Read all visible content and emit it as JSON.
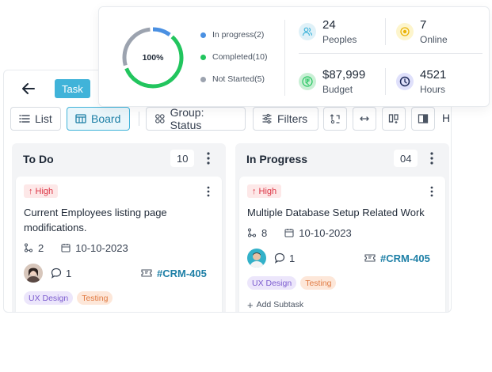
{
  "header": {
    "badge": "Task"
  },
  "toolbar": {
    "list_label": "List",
    "board_label": "Board",
    "group_label": "Group: Status",
    "filters_label": "Filters",
    "truncated_label": "Hi"
  },
  "columns": [
    {
      "title": "To Do",
      "count": "10",
      "card": {
        "priority": "High",
        "title": "Current Employees listing page modifications.",
        "subtasks": "2",
        "date": "10-10-2023",
        "comments": "1",
        "ticket": "#CRM-405",
        "tags": [
          "UX Design",
          "Testing"
        ]
      }
    },
    {
      "title": "In Progress",
      "count": "04",
      "card": {
        "priority": "High",
        "title": "Multiple Database Setup Related Work",
        "subtasks": "8",
        "date": "10-10-2023",
        "comments": "1",
        "ticket": "#CRM-405",
        "tags": [
          "UX Design",
          "Testing"
        ],
        "add_subtask": "Add Subtask"
      }
    }
  ],
  "summary": {
    "percent": "100%",
    "legend": [
      {
        "label": "In progress(2)",
        "color": "#4a90e2"
      },
      {
        "label": "Completed(10)",
        "color": "#22c55e"
      },
      {
        "label": "Not Started(5)",
        "color": "#9ca3af"
      }
    ],
    "stats": [
      {
        "value": "24",
        "label": "Peoples",
        "icon": "people-icon",
        "color": "#40b3d9"
      },
      {
        "value": "7",
        "label": "Online",
        "icon": "online-icon",
        "color": "#eab308"
      },
      {
        "value": "$87,999",
        "label": "Budget",
        "icon": "rupee-icon",
        "color": "#22c55e"
      },
      {
        "value": "4521",
        "label": "Hours",
        "icon": "clock-icon",
        "color": "#4f46e5"
      }
    ]
  }
}
